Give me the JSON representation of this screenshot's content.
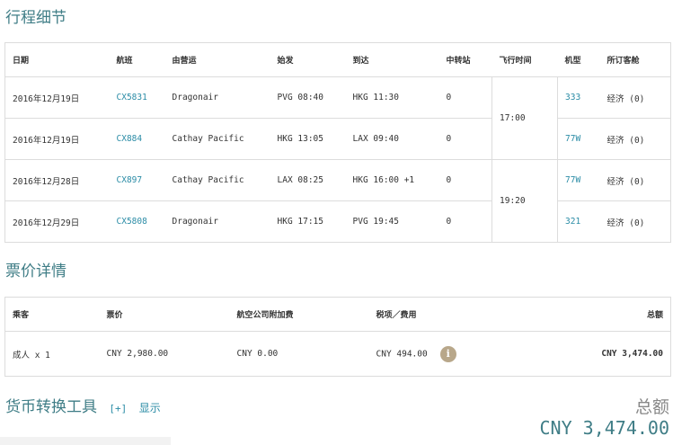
{
  "itinerary": {
    "title": "行程细节",
    "headers": [
      "日期",
      "航班",
      "由营运",
      "始发",
      "到达",
      "中转站",
      "飞行时间",
      "机型",
      "所订客舱"
    ],
    "rows": [
      {
        "date": "2016年12月19日",
        "flight": "CX5831",
        "operator": "Dragonair",
        "depart": "PVG 08:40",
        "arrive": "HKG 11:30",
        "stops": "0",
        "aircraft": "333",
        "cabin": "经济 (0)"
      },
      {
        "date": "2016年12月19日",
        "flight": "CX884",
        "operator": "Cathay Pacific",
        "depart": "HKG 13:05",
        "arrive": "LAX 09:40",
        "stops": "0",
        "aircraft": "77W",
        "cabin": "经济 (0)"
      },
      {
        "date": "2016年12月28日",
        "flight": "CX897",
        "operator": "Cathay Pacific",
        "depart": "LAX 08:25",
        "arrive": "HKG 16:00 +1",
        "stops": "0",
        "aircraft": "77W",
        "cabin": "经济 (0)"
      },
      {
        "date": "2016年12月29日",
        "flight": "CX5808",
        "operator": "Dragonair",
        "depart": "HKG 17:15",
        "arrive": "PVG 19:45",
        "stops": "0",
        "aircraft": "321",
        "cabin": "经济 (0)"
      }
    ],
    "durations": [
      "17:00",
      "19:20"
    ]
  },
  "fare": {
    "title": "票价详情",
    "headers": [
      "乘客",
      "票价",
      "航空公司附加费",
      "税项／费用",
      "总额"
    ],
    "row": {
      "passenger": "成人 x 1",
      "fare": "CNY 2,980.00",
      "surcharge": "CNY 0.00",
      "taxes": "CNY 494.00",
      "total": "CNY 3,474.00"
    },
    "info_icon": "info-icon"
  },
  "currency_tool": {
    "title": "货币转换工具",
    "toggle": "[+]",
    "show": "显示"
  },
  "total": {
    "label": "总额",
    "amount": "CNY 3,474.00"
  },
  "colors": {
    "accent": "#3f7d86",
    "link": "#2b8ca6",
    "info": "#b8a78a"
  }
}
